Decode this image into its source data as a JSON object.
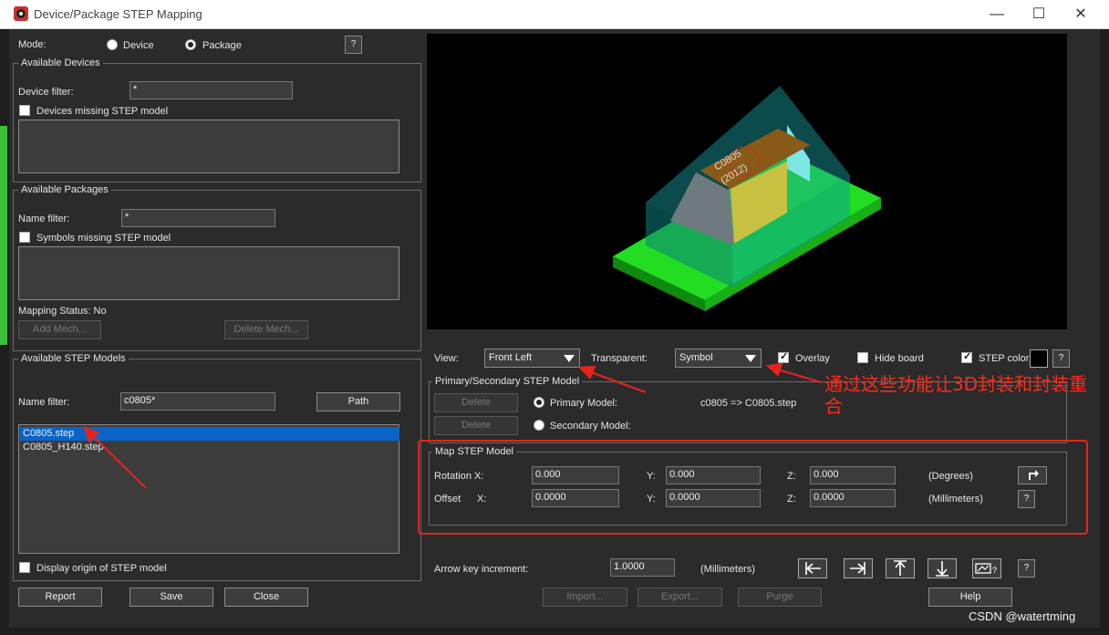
{
  "window": {
    "title": "Device/Package STEP Mapping",
    "minimize": "—",
    "maximize": "☐",
    "close": "✕"
  },
  "mode": {
    "label": "Mode:",
    "device": "Device",
    "package": "Package",
    "help": "?"
  },
  "available_devices": {
    "title": "Available Devices",
    "filter_label": "Device filter:",
    "filter_value": "*",
    "missing_label": "Devices missing STEP model"
  },
  "available_packages": {
    "title": "Available Packages",
    "filter_label": "Name filter:",
    "filter_value": "*",
    "missing_label": "Symbols missing STEP model",
    "mapping_status": "Mapping Status: No",
    "add_mech": "Add Mech...",
    "delete_mech": "Delete Mech..."
  },
  "available_step": {
    "title": "Available STEP Models",
    "filter_label": "Name filter:",
    "filter_value": "c0805*",
    "path_button": "Path",
    "items": [
      "C0805.step",
      "C0805_H140.step"
    ],
    "display_origin": "Display origin of STEP model"
  },
  "bottom_left": {
    "report": "Report",
    "save": "Save",
    "close": "Close"
  },
  "view_controls": {
    "view_label": "View:",
    "view_value": "Front Left",
    "transparent_label": "Transparent:",
    "transparent_value": "Symbol",
    "overlay": "Overlay",
    "hide_board": "Hide board",
    "step_color": "STEP color",
    "help": "?"
  },
  "primary_secondary": {
    "title": "Primary/Secondary STEP Model",
    "delete": "Delete",
    "primary_label": "Primary Model:",
    "secondary_label": "Secondary Model:",
    "primary_value": "c0805 => C0805.step"
  },
  "map_step": {
    "title": "Map STEP Model",
    "rotation_label": "Rotation X:",
    "offset_label": "Offset",
    "offset_x_label": "X:",
    "y_label": "Y:",
    "z_label": "Z:",
    "rot_x": "0.000",
    "rot_y": "0.000",
    "rot_z": "0.000",
    "off_x": "0.0000",
    "off_y": "0.0000",
    "off_z": "0.0000",
    "degrees": "(Degrees)",
    "millimeters": "(Millimeters)",
    "help": "?"
  },
  "arrow_key": {
    "label": "Arrow key increment:",
    "value": "1.0000",
    "units": "(Millimeters)",
    "help": "?"
  },
  "bottom_right": {
    "import": "Import...",
    "export": "Export...",
    "purge": "Purge",
    "help": "Help"
  },
  "model_label": {
    "line1": "C0805",
    "line2": "(2012)"
  },
  "annotation": {
    "text": "通过这些功能让3D封装和封装重合"
  },
  "watermark": "CSDN @watertming",
  "colors": {
    "board_green": "#22dd22",
    "cap_body": "#b88a2e",
    "overlay_cyan": "#00b3b3",
    "annotation_red": "#e8231c",
    "selection_blue": "#0a64c8"
  }
}
